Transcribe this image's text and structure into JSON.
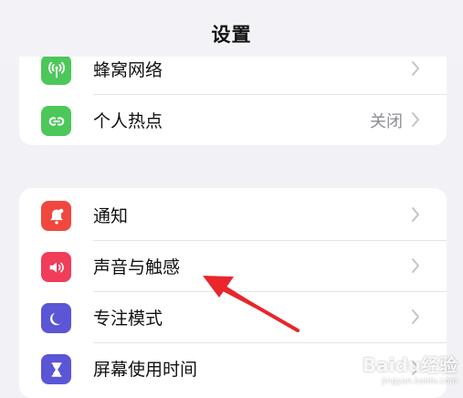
{
  "header": {
    "title": "设置"
  },
  "groups": [
    {
      "items": [
        {
          "label": "蜂窝网络",
          "value": "",
          "icon": "antenna-icon",
          "color": "#4cc75a"
        },
        {
          "label": "个人热点",
          "value": "关闭",
          "icon": "hotspot-link-icon",
          "color": "#4cc75a"
        }
      ]
    },
    {
      "items": [
        {
          "label": "通知",
          "value": "",
          "icon": "bell-icon",
          "color": "#f0483e"
        },
        {
          "label": "声音与触感",
          "value": "",
          "icon": "speaker-icon",
          "color": "#ef3d5a"
        },
        {
          "label": "专注模式",
          "value": "",
          "icon": "moon-icon",
          "color": "#5b56d6"
        },
        {
          "label": "屏幕使用时间",
          "value": "",
          "icon": "hourglass-icon",
          "color": "#5b56d6"
        }
      ]
    }
  ],
  "watermark": {
    "brand": "Baidu经验",
    "url": "jingyan.baidu.com"
  },
  "colors": {
    "annotation_arrow": "#e8262b",
    "chevron": "#c4c4c7"
  }
}
